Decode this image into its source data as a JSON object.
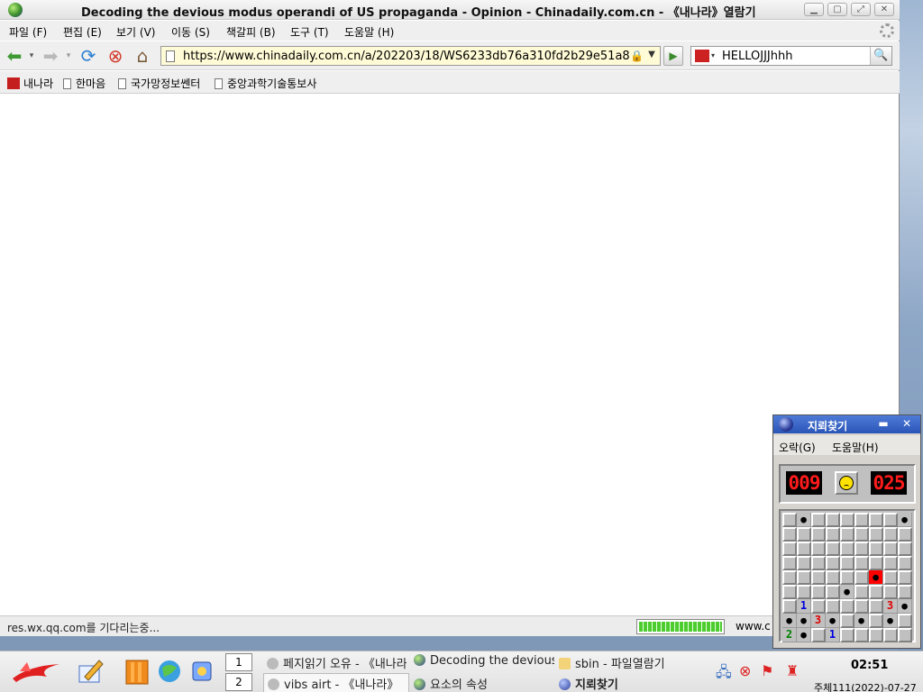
{
  "browser": {
    "title": "Decoding the devious modus operandi of US propaganda - Opinion - Chinadaily.com.cn - 《내나라》열람기",
    "menus": [
      "파일 (F)",
      "편집 (E)",
      "보기 (V)",
      "이동 (S)",
      "책갈피 (B)",
      "도구 (T)",
      "도움말 (H)"
    ],
    "url": "https://www.chinadaily.com.cn/a/202203/18/WS6233db76a310fd2b29e51a8",
    "search_value": "HELLOJJJhhh",
    "bookmarks": [
      "내나라",
      "한마음",
      "국가망정보쎈터",
      "중앙과학기술통보사"
    ],
    "status_text": "res.wx.qq.com를 기다리는중...",
    "status_right": "www.c",
    "progress": 1.0
  },
  "minesweeper": {
    "title": "지뢰찾기",
    "menus": [
      "오락(G)",
      "도움말(H)"
    ],
    "mines_left": "009",
    "time": "025",
    "face": "sad",
    "grid": [
      [
        "",
        "m",
        "",
        "",
        "",
        "",
        "",
        "",
        "m"
      ],
      [
        "",
        "",
        "",
        "",
        "",
        "",
        "",
        "",
        ""
      ],
      [
        "",
        "",
        "",
        "",
        "",
        "",
        "",
        "",
        ""
      ],
      [
        "",
        "",
        "",
        "",
        "",
        "",
        "",
        "",
        ""
      ],
      [
        "",
        "",
        "",
        "",
        "",
        "",
        "X",
        "",
        ""
      ],
      [
        "",
        "",
        "",
        "",
        "m",
        "",
        "",
        "",
        ""
      ],
      [
        "",
        "1",
        "",
        "",
        "",
        "",
        "",
        "3",
        "m"
      ],
      [
        "m",
        "m",
        "3",
        "m",
        "",
        "m",
        "",
        "m",
        ""
      ],
      [
        "2",
        "m",
        "",
        "1",
        "",
        "",
        "",
        "",
        ""
      ]
    ]
  },
  "taskbar": {
    "workspaces": [
      "1",
      "2"
    ],
    "tasks": [
      "페지읽기 오유 - 《내나라",
      "Decoding the devious",
      "sbin - 파일열람기",
      "vibs airt - 《내나라》",
      "요소의 속성",
      "지뢰찾기"
    ],
    "clock": "02:51",
    "date": "주체111(2022)-07-27"
  },
  "colors": {
    "accent": "#2a55b8",
    "urlbar": "#fffbd6",
    "progress": "#4ccc2e"
  }
}
